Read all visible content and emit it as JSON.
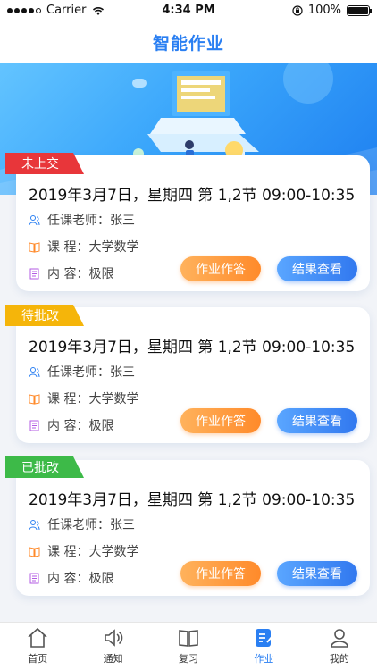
{
  "status_bar": {
    "carrier": "Carrier",
    "time": "4:34 PM",
    "battery": "100%"
  },
  "header": {
    "title": "智能作业"
  },
  "cards": [
    {
      "status": "未上交",
      "status_color": "#e8363a",
      "time": "2019年3月7日，星期四  第 1,2节  09:00-10:35",
      "teacher_label": "任课老师：",
      "teacher": "张三",
      "course_label": "课    程：",
      "course": "大学数学",
      "content_label": "内    容：",
      "content": "极限",
      "answer_btn": "作业作答",
      "result_btn": "结果查看"
    },
    {
      "status": "待批改",
      "status_color": "#f5b50a",
      "time": "2019年3月7日，星期四  第 1,2节  09:00-10:35",
      "teacher_label": "任课老师：",
      "teacher": "张三",
      "course_label": "课    程：",
      "course": "大学数学",
      "content_label": "内    容：",
      "content": "极限",
      "answer_btn": "作业作答",
      "result_btn": "结果查看"
    },
    {
      "status": "已批改",
      "status_color": "#3dba48",
      "time": "2019年3月7日，星期四  第 1,2节  09:00-10:35",
      "teacher_label": "任课老师：",
      "teacher": "张三",
      "course_label": "课    程：",
      "course": "大学数学",
      "content_label": "内    容：",
      "content": "极限",
      "answer_btn": "作业作答",
      "result_btn": "结果查看"
    }
  ],
  "tabs": [
    {
      "label": "首页",
      "icon": "home-icon"
    },
    {
      "label": "通知",
      "icon": "speaker-icon"
    },
    {
      "label": "复习",
      "icon": "book-icon"
    },
    {
      "label": "作业",
      "icon": "homework-icon",
      "active": true
    },
    {
      "label": "我的",
      "icon": "user-icon"
    }
  ],
  "colors": {
    "accent": "#2a7ff2",
    "orange": "#ff8a2a",
    "blue_button": "#3178ef"
  }
}
